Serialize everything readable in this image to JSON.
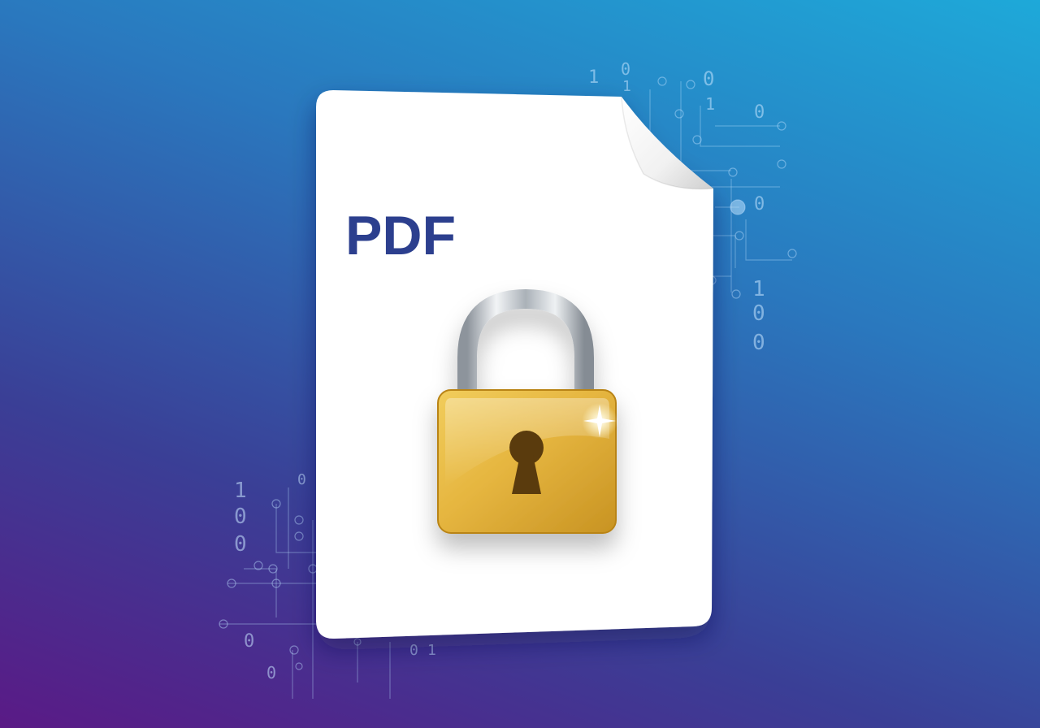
{
  "document": {
    "label": "PDF",
    "icon": "lock-icon"
  },
  "decor": {
    "binary_right": [
      "1",
      "0",
      "1",
      "0",
      "0",
      "0",
      "1",
      "1",
      "0",
      "0"
    ],
    "binary_left": [
      "1",
      "0",
      "0",
      "0",
      "0",
      "0",
      "1",
      "0"
    ]
  },
  "colors": {
    "background_top_right": "#1ea9d9",
    "background_bottom_left": "#5a1a86",
    "label": "#2c3f8e",
    "lock_body": "#e3b43c",
    "shackle": "#c7ccd2"
  }
}
